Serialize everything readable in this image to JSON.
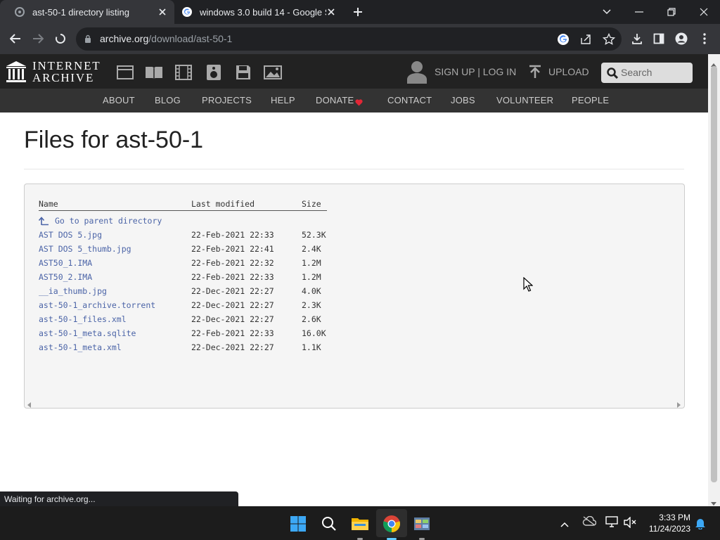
{
  "browser": {
    "tabs": [
      {
        "title": "ast-50-1 directory listing",
        "active": true
      },
      {
        "title": "windows 3.0 build 14 - Google Se",
        "active": false
      }
    ],
    "url_host": "archive.org",
    "url_path": "/download/ast-50-1"
  },
  "ia": {
    "logo_line1": "INTERNET",
    "logo_line2": "ARCHIVE",
    "signup_label": "SIGN UP | LOG IN",
    "upload_label": "UPLOAD",
    "search_placeholder": "Search",
    "nav": [
      "ABOUT",
      "BLOG",
      "PROJECTS",
      "HELP",
      "DONATE",
      "CONTACT",
      "JOBS",
      "VOLUNTEER",
      "PEOPLE"
    ]
  },
  "page": {
    "title": "Files for ast-50-1",
    "columns": {
      "name": "Name",
      "modified": "Last modified",
      "size": "Size"
    },
    "parent_link": "Go to parent directory",
    "files": [
      {
        "name": "AST DOS 5.jpg",
        "modified": "22-Feb-2021 22:33",
        "size": "52.3K"
      },
      {
        "name": "AST DOS 5_thumb.jpg",
        "modified": "22-Feb-2021 22:41",
        "size": "2.4K"
      },
      {
        "name": "AST50_1.IMA",
        "modified": "22-Feb-2021 22:32",
        "size": "1.2M"
      },
      {
        "name": "AST50_2.IMA",
        "modified": "22-Feb-2021 22:33",
        "size": "1.2M"
      },
      {
        "name": "__ia_thumb.jpg",
        "modified": "22-Dec-2021 22:27",
        "size": "4.0K"
      },
      {
        "name": "ast-50-1_archive.torrent",
        "modified": "22-Dec-2021 22:27",
        "size": "2.3K"
      },
      {
        "name": "ast-50-1_files.xml",
        "modified": "22-Dec-2021 22:27",
        "size": "2.6K"
      },
      {
        "name": "ast-50-1_meta.sqlite",
        "modified": "22-Feb-2021 22:33",
        "size": "16.0K"
      },
      {
        "name": "ast-50-1_meta.xml",
        "modified": "22-Dec-2021 22:27",
        "size": "1.1K"
      }
    ]
  },
  "status_text": "Waiting for archive.org...",
  "taskbar": {
    "time": "3:33 PM",
    "date": "11/24/2023"
  },
  "colors": {
    "link": "#4b64a7",
    "donate_heart": "#e32636",
    "win_blue": "#0078d4"
  }
}
